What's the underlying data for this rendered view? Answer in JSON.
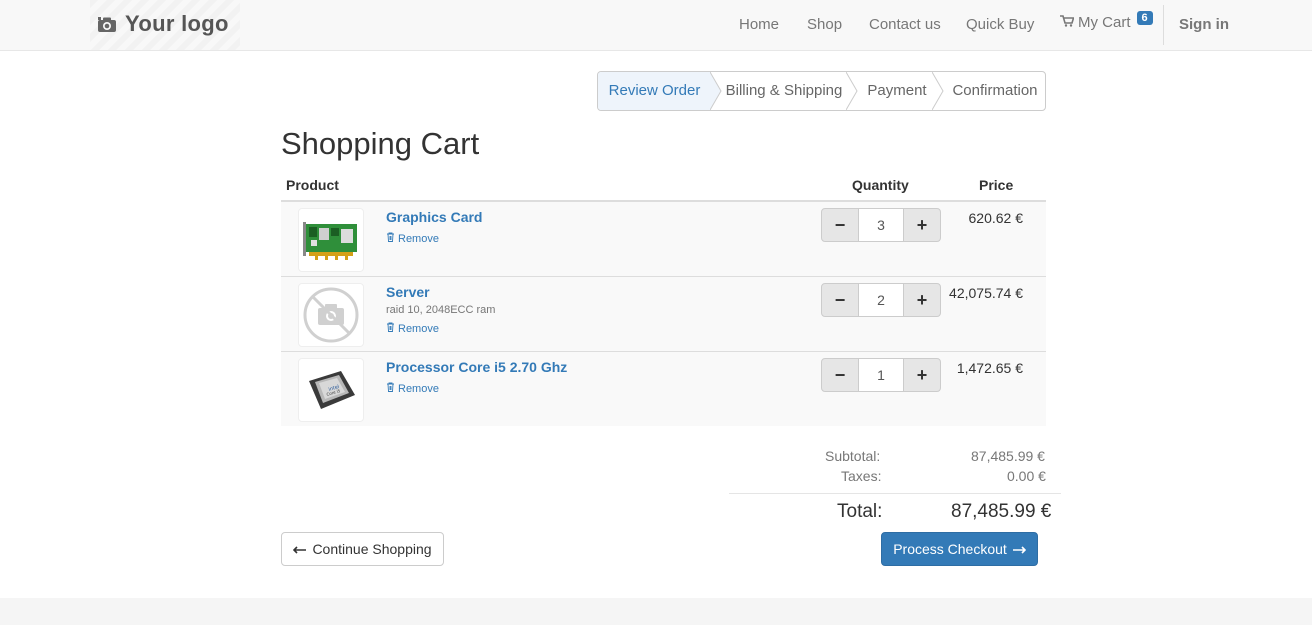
{
  "navbar": {
    "logo_text": "Your logo",
    "links": [
      "Home",
      "Shop",
      "Contact us",
      "Quick Buy"
    ],
    "cart_label": "My Cart",
    "cart_count": "6",
    "sign_in": "Sign in"
  },
  "wizard": {
    "steps": [
      "Review Order",
      "Billing & Shipping",
      "Payment",
      "Confirmation"
    ],
    "active_step": "Review Order"
  },
  "page_title": "Shopping Cart",
  "table_headers": {
    "product": "Product",
    "quantity": "Quantity",
    "price": "Price"
  },
  "cart_items": [
    {
      "name": "Graphics Card",
      "description": "",
      "remove": "Remove",
      "quantity": "3",
      "price": "620.62 €",
      "image": "graphics-card-image"
    },
    {
      "name": "Server",
      "description": "raid 10, 2048ECC ram",
      "remove": "Remove",
      "quantity": "2",
      "price": "42,075.74 €",
      "image": "no-image-placeholder"
    },
    {
      "name": "Processor Core i5 2.70 Ghz",
      "description": "",
      "remove": "Remove",
      "quantity": "1",
      "price": "1,472.65 €",
      "image": "processor-image"
    }
  ],
  "totals": {
    "subtotal_label": "Subtotal:",
    "subtotal_value": "87,485.99 €",
    "taxes_label": "Taxes:",
    "taxes_value": "0.00 €",
    "total_label": "Total:",
    "total_value": "87,485.99 €"
  },
  "buttons": {
    "continue": "Continue Shopping",
    "checkout": "Process Checkout"
  },
  "colors": {
    "link": "#337ab7",
    "primary": "#337ab7",
    "navbar_bg": "#f8f8f8",
    "row_bg": "#f9f9f9"
  }
}
